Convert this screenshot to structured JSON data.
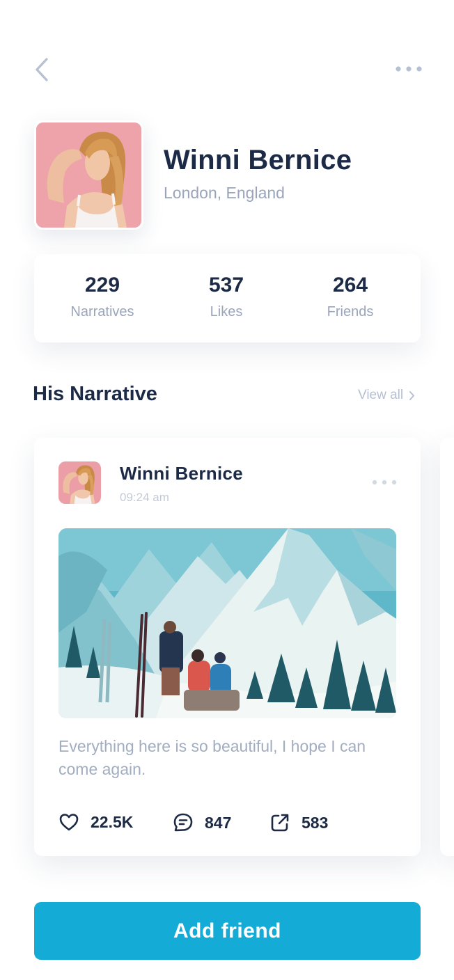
{
  "nav": {
    "back_icon": "chevron-left-icon",
    "more_icon": "more-horizontal-icon"
  },
  "profile": {
    "name": "Winni Bernice",
    "location": "London, England"
  },
  "stats": [
    {
      "value": "229",
      "label": "Narratives"
    },
    {
      "value": "537",
      "label": "Likes"
    },
    {
      "value": "264",
      "label": "Friends"
    }
  ],
  "section": {
    "title": "His Narrative",
    "view_all": "View all"
  },
  "post": {
    "author": "Winni Bernice",
    "time": "09:24 am",
    "text": "Everything here is so beautiful, I hope I can come again.",
    "likes": "22.5K",
    "comments": "847",
    "shares": "583"
  },
  "cta": {
    "label": "Add friend"
  },
  "colors": {
    "accent": "#14acd6",
    "title_text": "#1c2a45",
    "muted_text": "#9aa5bb"
  }
}
